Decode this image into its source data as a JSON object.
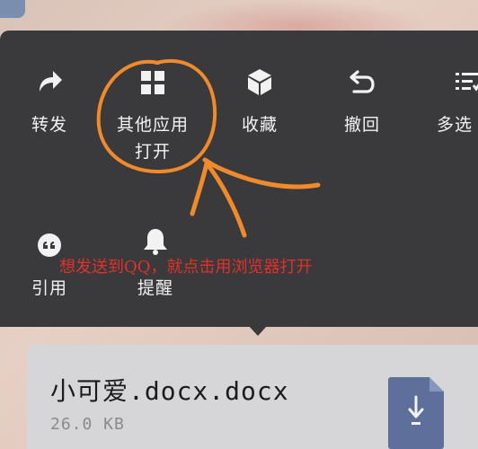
{
  "menu": {
    "items": [
      {
        "label": "转发",
        "icon": "forward-icon"
      },
      {
        "label": "其他应用",
        "label2": "打开",
        "icon": "other-apps-icon"
      },
      {
        "label": "收藏",
        "icon": "favorite-cube-icon"
      },
      {
        "label": "撤回",
        "icon": "undo-icon"
      },
      {
        "label": "多选",
        "icon": "multi-select-icon"
      },
      {
        "label": "引用",
        "icon": "quote-icon"
      },
      {
        "label": "提醒",
        "icon": "bell-icon"
      }
    ]
  },
  "annotation": {
    "text": "想发送到QQ，就点击用浏览器打开",
    "color": "#e2302a",
    "stroke_color": "#f08a2c"
  },
  "file": {
    "name": "小可爱.docx.docx",
    "size": "26.0 KB",
    "icon": "document-download-icon"
  }
}
